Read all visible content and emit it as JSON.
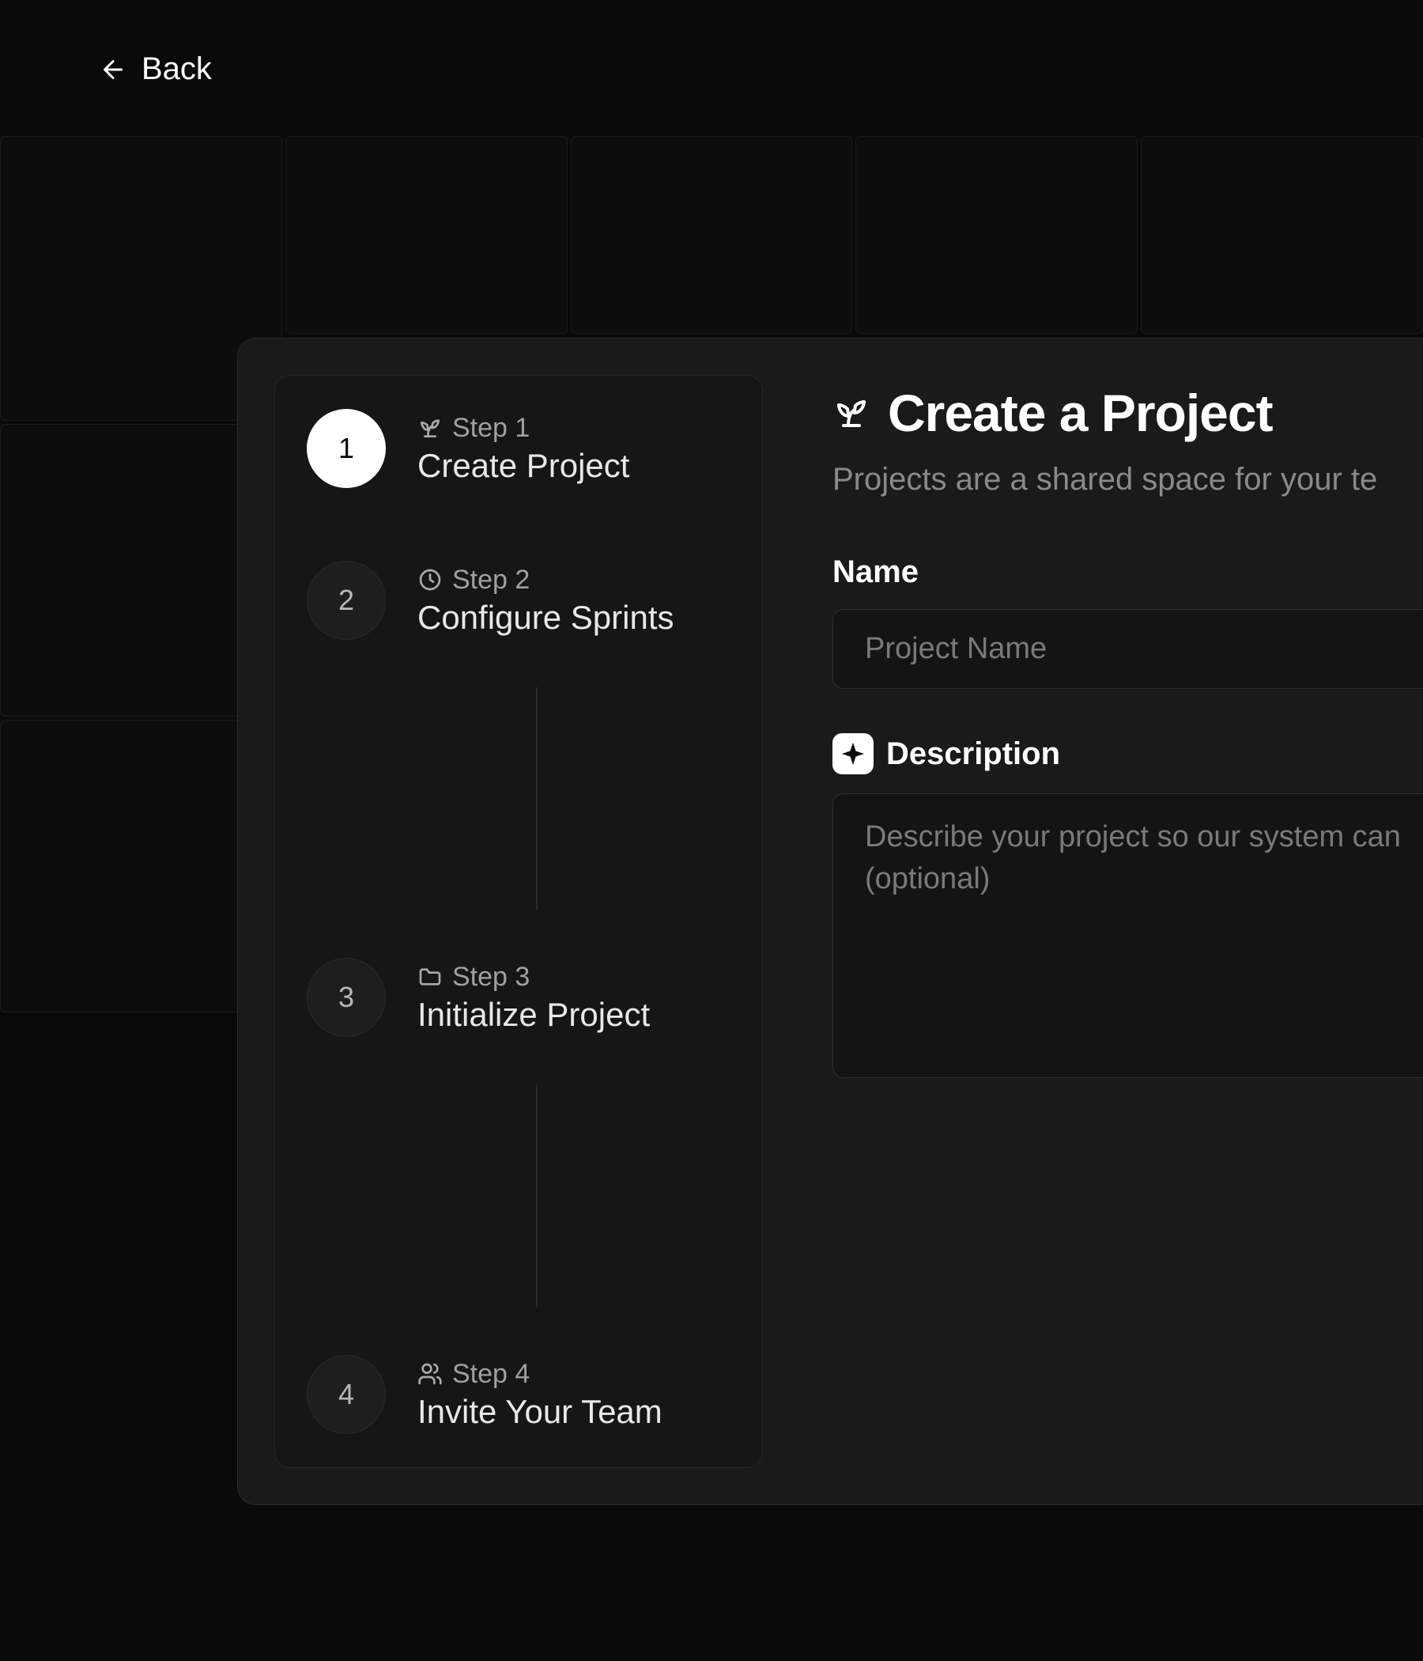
{
  "nav": {
    "back_label": "Back"
  },
  "steps": [
    {
      "num": "1",
      "label": "Step 1",
      "title": "Create Project",
      "icon": "sprout-icon",
      "active": true
    },
    {
      "num": "2",
      "label": "Step 2",
      "title": "Configure Sprints",
      "icon": "clock-icon",
      "active": false
    },
    {
      "num": "3",
      "label": "Step 3",
      "title": "Initialize Project",
      "icon": "folder-icon",
      "active": false
    },
    {
      "num": "4",
      "label": "Step 4",
      "title": "Invite Your Team",
      "icon": "users-icon",
      "active": false
    }
  ],
  "main": {
    "title": "Create a Project",
    "subtitle": "Projects are a shared space for your te",
    "fields": {
      "name_label": "Name",
      "name_placeholder": "Project Name",
      "description_label": "Description",
      "description_placeholder": "Describe your project so our system can (optional)"
    }
  }
}
